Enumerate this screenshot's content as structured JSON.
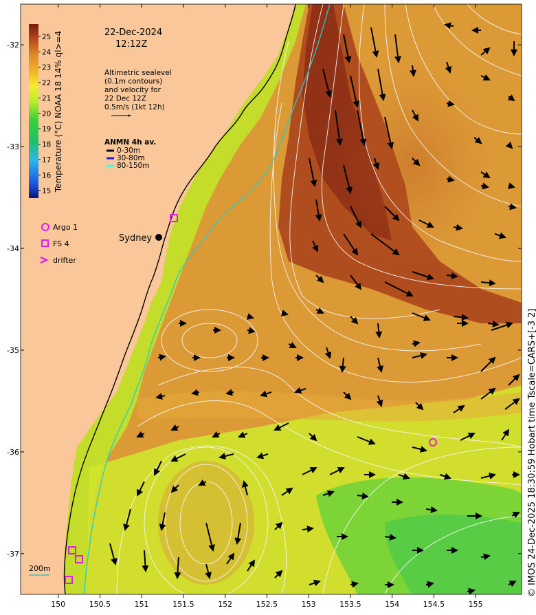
{
  "date": "22-Dec-2024",
  "time": "12:12Z",
  "altimetry_note": [
    "Altimetric sealevel",
    "(0.1m contours)",
    "and velocity for",
    "22 Dec 12Z",
    "0.5m/s (1kt 12h)"
  ],
  "anmn_title": "ANMN 4h av.",
  "anmn_legend": [
    {
      "label": "0-30m",
      "color": "#000000"
    },
    {
      "label": "30-80m",
      "color": "#1a1aff"
    },
    {
      "label": "80-150m",
      "color": "#33ffff"
    }
  ],
  "colorbar": {
    "label": "Temperature (°C) NOAA 18 14% ql>=4",
    "ticks": [
      "15",
      "16",
      "17",
      "18",
      "19",
      "20",
      "21",
      "22",
      "23",
      "24",
      "25"
    ],
    "min": 14.5,
    "max": 25.8
  },
  "markers_legend": [
    {
      "label": "Argo 1",
      "symbol": "circle",
      "color": "#e020e0"
    },
    {
      "label": "FS 4",
      "symbol": "square",
      "color": "#e020e0"
    },
    {
      "label": "drifter",
      "symbol": "chevron",
      "color": "#e020e0"
    }
  ],
  "places": [
    {
      "name": "Sydney",
      "lon": 151.2,
      "lat": -33.87
    }
  ],
  "isobath_label": "200m",
  "x_ticks": [
    "150",
    "150.5",
    "151",
    "151.5",
    "152",
    "152.5",
    "153",
    "153.5",
    "154",
    "154.5",
    "155"
  ],
  "y_ticks": [
    "-32",
    "-33",
    "-34",
    "-35",
    "-36",
    "-37"
  ],
  "extent": {
    "lon": [
      149.55,
      155.55
    ],
    "lat": [
      -37.4,
      -31.6
    ]
  },
  "argo_floats": [
    {
      "lon": 154.45,
      "lat": -35.92
    }
  ],
  "fs_sites": [
    {
      "lon": 151.32,
      "lat": -33.7
    },
    {
      "lon": 150.12,
      "lat": -36.8
    },
    {
      "lon": 150.2,
      "lat": -36.87
    },
    {
      "lon": 150.08,
      "lat": -37.07
    }
  ],
  "copyright": "© IMOS 24-Dec-2025 18:30:59 Hobart time Tscale=CARS+[-3 2]",
  "colors": {
    "land": "#f9c79a",
    "coast": "#000000",
    "isobath": "#22cccc",
    "contour": "#f5f5f5"
  }
}
